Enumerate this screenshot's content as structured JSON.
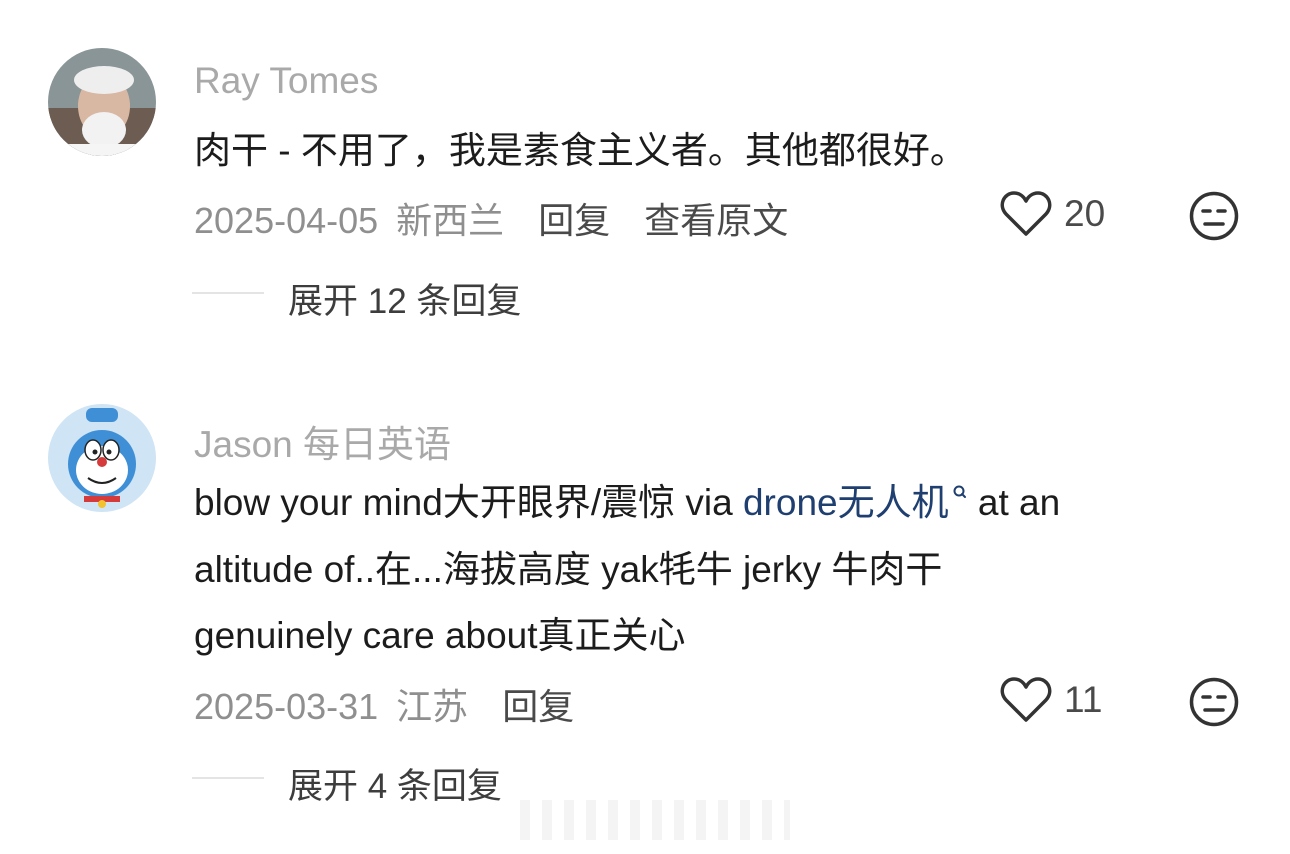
{
  "comments": [
    {
      "username": "Ray Tomes",
      "text": "肉干 - 不用了，我是素食主义者。其他都很好。",
      "date": "2025-04-05",
      "location": "新西兰",
      "reply_label": "回复",
      "view_original_label": "查看原文",
      "likes": "20",
      "expand_label": "展开 12 条回复"
    },
    {
      "username": "Jason 每日英语",
      "text_line1_before": "blow your mind大开眼界/震惊 via ",
      "text_line1_link": "drone无人机",
      "text_line1_after": " at an",
      "text_line2": "altitude of..在...海拔高度 yak牦牛 jerky 牛肉干",
      "text_line3": "genuinely care about真正关心",
      "date": "2025-03-31",
      "location": "江苏",
      "reply_label": "回复",
      "likes": "11",
      "expand_label": "展开 4 条回复"
    }
  ],
  "colors": {
    "username": "#a9a9a9",
    "link": "#1f3f70",
    "meta": "#8f8f8f"
  },
  "icons": [
    "heart-outline-icon",
    "dislike-face-icon",
    "search-icon"
  ]
}
